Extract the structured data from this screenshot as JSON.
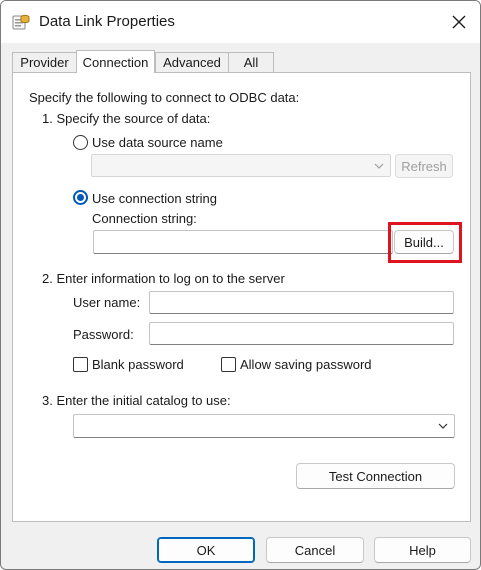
{
  "window": {
    "title": "Data Link Properties"
  },
  "tabs": [
    {
      "label": "Provider",
      "active": false
    },
    {
      "label": "Connection",
      "active": true
    },
    {
      "label": "Advanced",
      "active": false
    },
    {
      "label": "All",
      "active": false
    }
  ],
  "connection": {
    "intro": "Specify the following to connect to ODBC data:",
    "step1": "1. Specify the source of data:",
    "use_dsn_label": "Use data source name",
    "dsn_value": "",
    "refresh_label": "Refresh",
    "use_connstring_label": "Use connection string",
    "connstring_caption": "Connection string:",
    "connstring_value": "",
    "build_label": "Build...",
    "step2": "2. Enter information to log on to the server",
    "username_label": "User name:",
    "username_value": "",
    "password_label": "Password:",
    "password_value": "",
    "blank_password_label": "Blank password",
    "allow_saving_label": "Allow saving password",
    "step3": "3. Enter the initial catalog to use:",
    "catalog_value": "",
    "test_connection_label": "Test Connection"
  },
  "footer": {
    "ok_label": "OK",
    "cancel_label": "Cancel",
    "help_label": "Help"
  },
  "colors": {
    "accent": "#0058b8",
    "highlight": "#e0141e"
  },
  "icons": {
    "app": "data-link-icon",
    "close": "close-icon",
    "chevron": "chevron-down-icon"
  }
}
